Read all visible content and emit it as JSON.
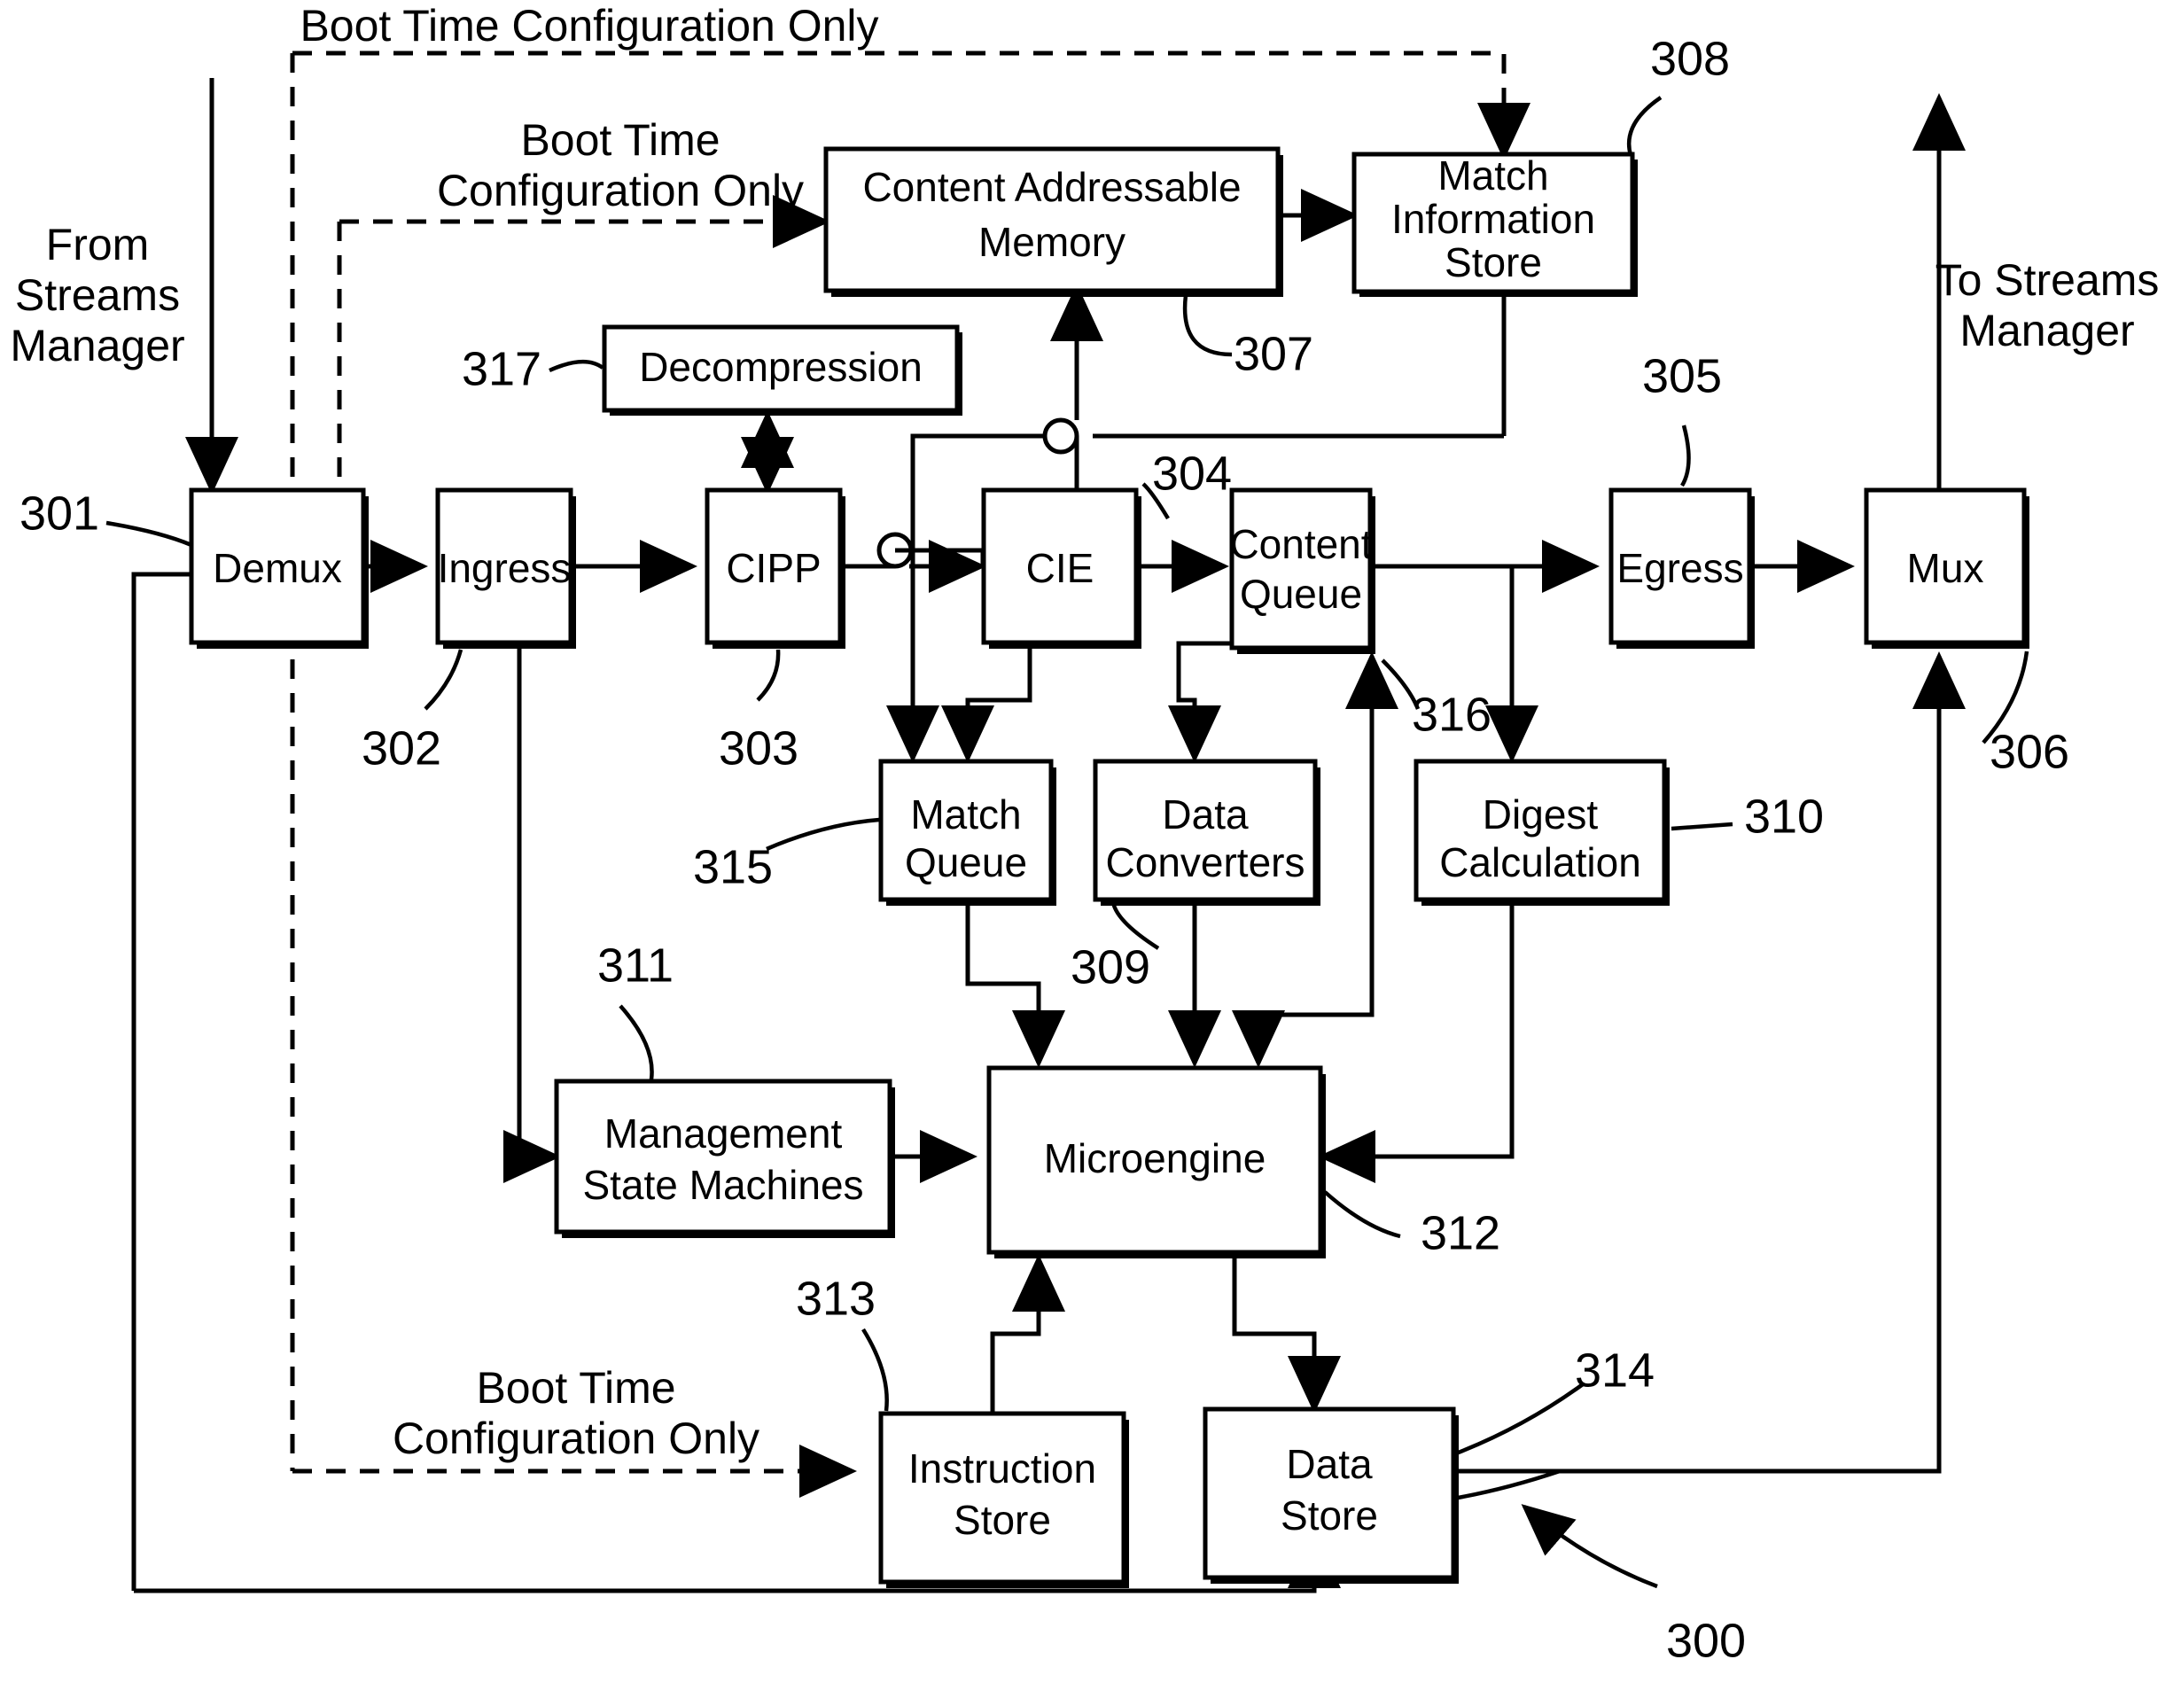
{
  "figure": {
    "title": "Content Inspection Engine block diagram",
    "overall_ref": "300"
  },
  "annotations": {
    "boot_top": "Boot Time Configuration Only",
    "boot_mid_l1": "Boot Time",
    "boot_mid_l2": "Configuration Only",
    "boot_bottom_l1": "Boot Time",
    "boot_bottom_l2": "Configuration Only",
    "from_streams_l1": "From",
    "from_streams_l2": "Streams",
    "from_streams_l3": "Manager",
    "to_streams_l1": "To Streams",
    "to_streams_l2": "Manager"
  },
  "blocks": [
    {
      "id": "demux",
      "label_lines": [
        "Demux"
      ],
      "ref": "301"
    },
    {
      "id": "ingress",
      "label_lines": [
        "Ingress"
      ],
      "ref": "302"
    },
    {
      "id": "cipp",
      "label_lines": [
        "CIPP"
      ],
      "ref": "303"
    },
    {
      "id": "cie",
      "label_lines": [
        "CIE"
      ],
      "ref": "304"
    },
    {
      "id": "content_queue",
      "label_lines": [
        "Content",
        "Queue"
      ],
      "ref": "316"
    },
    {
      "id": "egress",
      "label_lines": [
        "Egress"
      ],
      "ref": "305"
    },
    {
      "id": "mux",
      "label_lines": [
        "Mux"
      ],
      "ref": "306"
    },
    {
      "id": "cam",
      "label_lines": [
        "Content Addressable",
        "Memory"
      ],
      "ref": "307"
    },
    {
      "id": "mis",
      "label_lines": [
        "Match",
        "Information",
        "Store"
      ],
      "ref": "308"
    },
    {
      "id": "decompression",
      "label_lines": [
        "Decompression"
      ],
      "ref": "317"
    },
    {
      "id": "match_queue",
      "label_lines": [
        "Match",
        "Queue"
      ],
      "ref": "315"
    },
    {
      "id": "data_conv",
      "label_lines": [
        "Data",
        "Converters"
      ],
      "ref": "309"
    },
    {
      "id": "digest",
      "label_lines": [
        "Digest",
        "Calculation"
      ],
      "ref": "310"
    },
    {
      "id": "msm",
      "label_lines": [
        "Management",
        "State Machines"
      ],
      "ref": "311"
    },
    {
      "id": "microengine",
      "label_lines": [
        "Microengine"
      ],
      "ref": "312"
    },
    {
      "id": "instr_store",
      "label_lines": [
        "Instruction",
        "Store"
      ],
      "ref": "313"
    },
    {
      "id": "data_store",
      "label_lines": [
        "Data",
        "Store"
      ],
      "ref": "314"
    }
  ],
  "refs": {
    "r300": "300",
    "r301": "301",
    "r302": "302",
    "r303": "303",
    "r304": "304",
    "r305": "305",
    "r306": "306",
    "r307": "307",
    "r308": "308",
    "r309": "309",
    "r310": "310",
    "r311": "311",
    "r312": "312",
    "r313": "313",
    "r314": "314",
    "r315": "315",
    "r316": "316",
    "r317": "317"
  },
  "block_text": {
    "demux": "Demux",
    "ingress": "Ingress",
    "cipp": "CIPP",
    "cie": "CIE",
    "content_queue_1": "Content",
    "content_queue_2": "Queue",
    "egress": "Egress",
    "mux": "Mux",
    "cam_1": "Content Addressable",
    "cam_2": "Memory",
    "mis_1": "Match",
    "mis_2": "Information",
    "mis_3": "Store",
    "decompression": "Decompression",
    "match_queue_1": "Match",
    "match_queue_2": "Queue",
    "data_conv_1": "Data",
    "data_conv_2": "Converters",
    "digest_1": "Digest",
    "digest_2": "Calculation",
    "msm_1": "Management",
    "msm_2": "State Machines",
    "microengine": "Microengine",
    "instr_store_1": "Instruction",
    "instr_store_2": "Store",
    "data_store_1": "Data",
    "data_store_2": "Store"
  },
  "colors": {
    "ink": "#000000",
    "paper": "#ffffff"
  }
}
